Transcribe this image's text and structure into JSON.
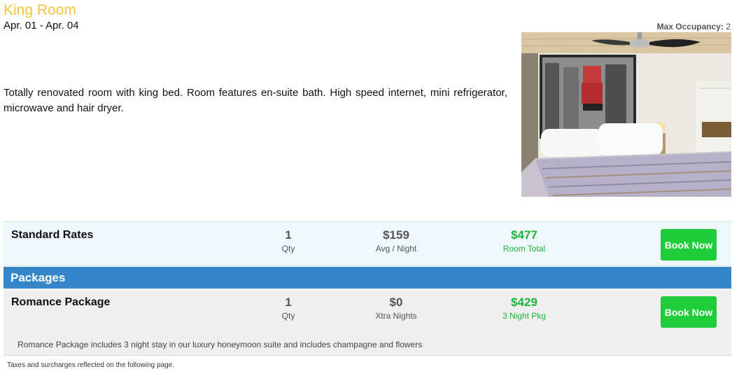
{
  "room": {
    "title": "King Room",
    "dates": "Apr. 01 - Apr. 04",
    "max_occupancy_label": "Max Occupancy:",
    "max_occupancy_value": "2",
    "description": "Totally renovated room with king bed. Room features en-suite bath. High speed internet, mini refrigerator, microwave and hair dryer."
  },
  "standard": {
    "name": "Standard Rates",
    "qty": "1",
    "qty_label": "Qty",
    "avg": "$159",
    "avg_label": "Avg / Night",
    "total": "$477",
    "total_label": "Room Total",
    "book_label": "Book Now"
  },
  "packages": {
    "header": "Packages",
    "romance": {
      "name": "Romance Package",
      "qty": "1",
      "qty_label": "Qty",
      "extra": "$0",
      "extra_label": "Xtra Nights",
      "total": "$429",
      "total_label": "3 Night Pkg",
      "book_label": "Book Now",
      "description": "Romance Package includes 3 night stay in our luxury honeymoon suite and includes champagne and flowers"
    }
  },
  "footer": {
    "taxes_note": "Taxes and surcharges reflected on the following page."
  },
  "colors": {
    "title": "#f5c242",
    "packages_bar": "#3586c8",
    "book_button": "#1fcc3a",
    "total_green": "#1db33a"
  }
}
